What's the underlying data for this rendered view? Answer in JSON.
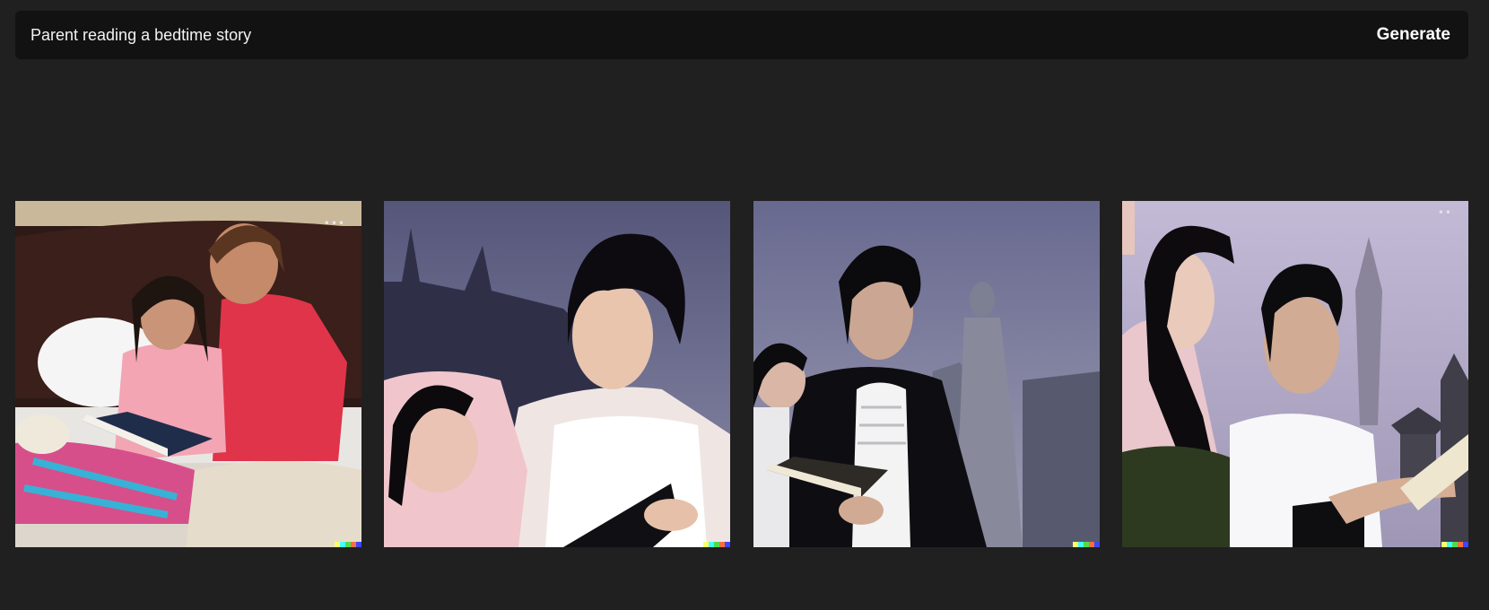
{
  "prompt": {
    "text": "Parent reading a bedtime story",
    "generate_label": "Generate"
  },
  "gallery": {
    "images": [
      {
        "alt": "Parent reading a bedtime story"
      },
      {
        "alt": "Parent reading a bedtime story"
      },
      {
        "alt": "Parent reading a bedtime story"
      },
      {
        "alt": "Parent reading a bedtime story"
      }
    ],
    "signature_colors": [
      "#ffff66",
      "#42ffff",
      "#51da4c",
      "#ff6e3c",
      "#3c46ff"
    ]
  },
  "colors": {
    "page_background": "#202020",
    "bar_background": "#121212",
    "text": "#ffffff"
  }
}
